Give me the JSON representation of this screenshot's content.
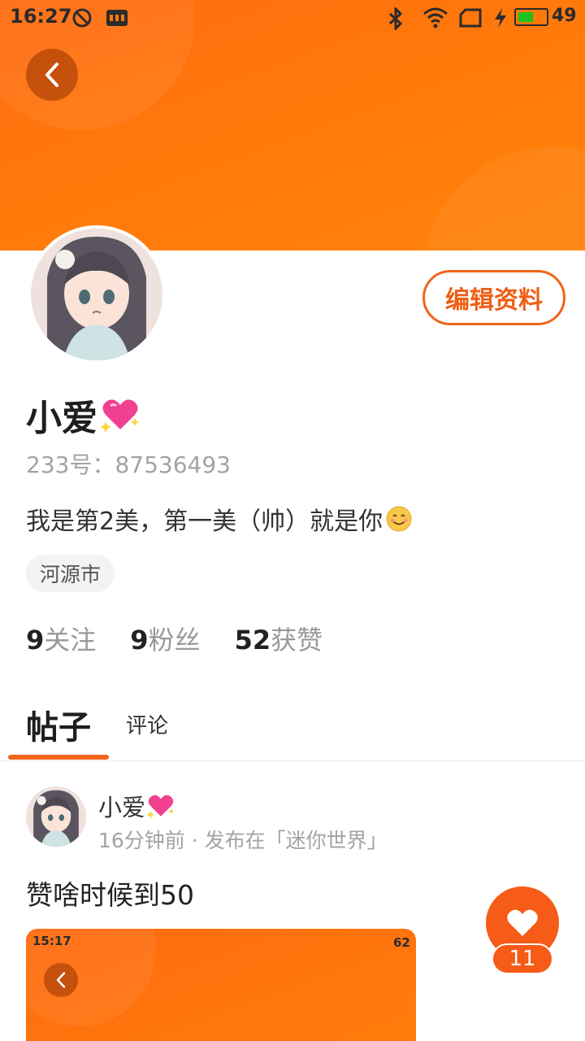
{
  "status_bar": {
    "time": "16:27",
    "battery_level": "49",
    "icons": [
      "do-not-disturb-icon",
      "sim-icon",
      "bluetooth-icon",
      "wifi-icon",
      "screen-icon",
      "charging-icon",
      "battery-icon"
    ]
  },
  "profile": {
    "name": "小爱",
    "name_emoji": "sparkling-heart-icon",
    "uid_label": "233号：87536493",
    "bio": "我是第2美，第一美（帅）就是你",
    "bio_emoji": "smile-icon",
    "location": "河源市",
    "edit_label": "编辑资料",
    "stats": {
      "following_num": "9",
      "following_label": "关注",
      "fans_num": "9",
      "fans_label": "粉丝",
      "likes_num": "52",
      "likes_label": "获赞"
    }
  },
  "tabs": {
    "posts": "帖子",
    "comments": "评论"
  },
  "post": {
    "author": "小爱",
    "meta": "16分钟前 · 发布在「迷你世界」",
    "text": "赞啥时候到50",
    "image_status_time": "15:17",
    "image_battery": "62",
    "like_count": "11"
  },
  "colors": {
    "accent": "#f1641b",
    "banner": "#ff7a0b"
  }
}
